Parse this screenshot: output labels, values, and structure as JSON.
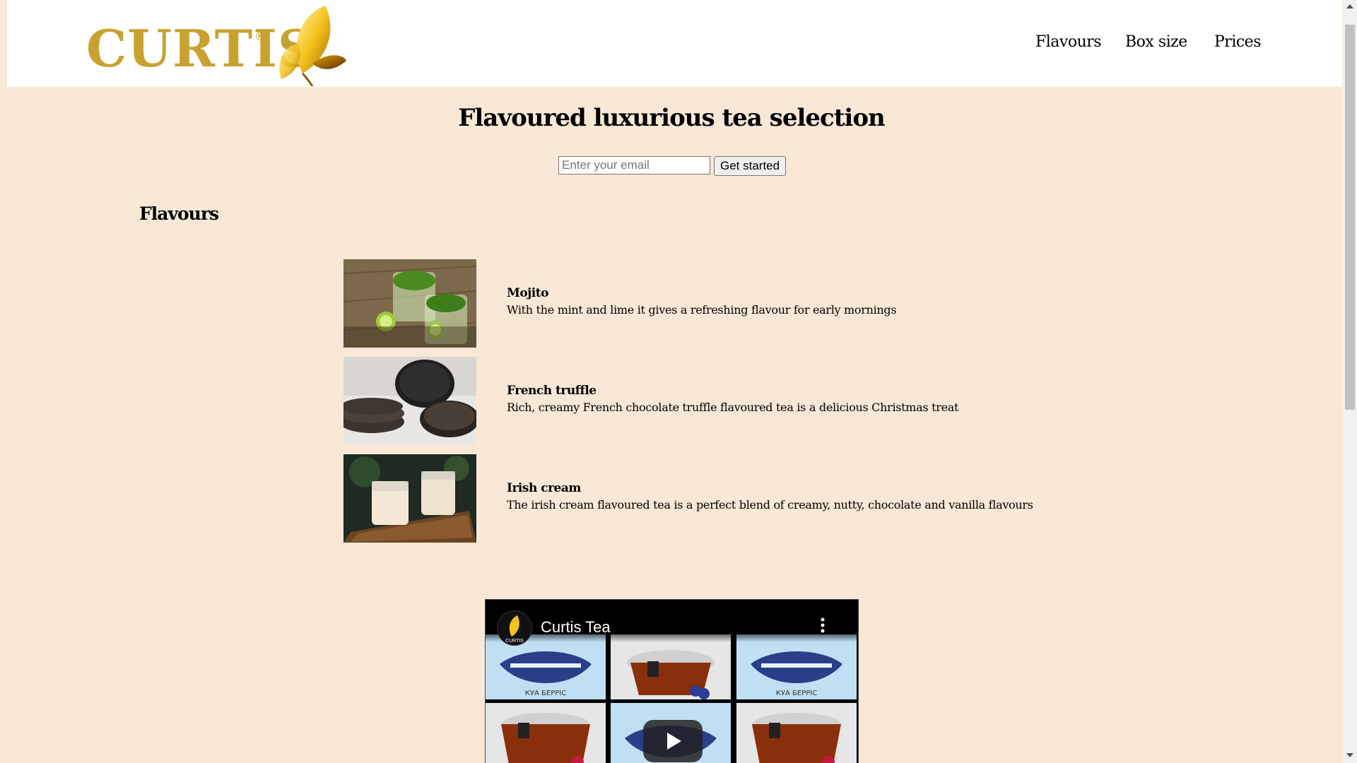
{
  "header": {
    "logo_text": "CURTIS",
    "logo_reg": "®",
    "nav": [
      {
        "label": "Flavours"
      },
      {
        "label": "Box size"
      },
      {
        "label": "Prices"
      }
    ]
  },
  "hero": {
    "title": "Flavoured luxurious tea selection",
    "email_placeholder": "Enter your email",
    "cta_label": "Get started"
  },
  "flavours_section": {
    "title": "Flavours",
    "items": [
      {
        "name": "Mojito",
        "description": "With the mint and lime it gives a refreshing flavour for early mornings",
        "image": "mojito-drink-photo"
      },
      {
        "name": "French truffle",
        "description": "Rich, creamy French chocolate truffle flavoured tea is a delicious Christmas treat",
        "image": "truffle-photo"
      },
      {
        "name": "Irish cream",
        "description": "The irish cream flavoured tea is a perfect blend of creamy, nutty, chocolate and vanilla flavours",
        "image": "irish-cream-drink-photo"
      }
    ]
  },
  "video": {
    "channel_title": "Curtis Tea",
    "avatar_text": "CURTIS",
    "tile_caption": "КУА БЕРРІС"
  },
  "colors": {
    "page_bg": "#f8e8d5",
    "header_bg": "#ffffff",
    "logo_gold": "#c8a130"
  }
}
